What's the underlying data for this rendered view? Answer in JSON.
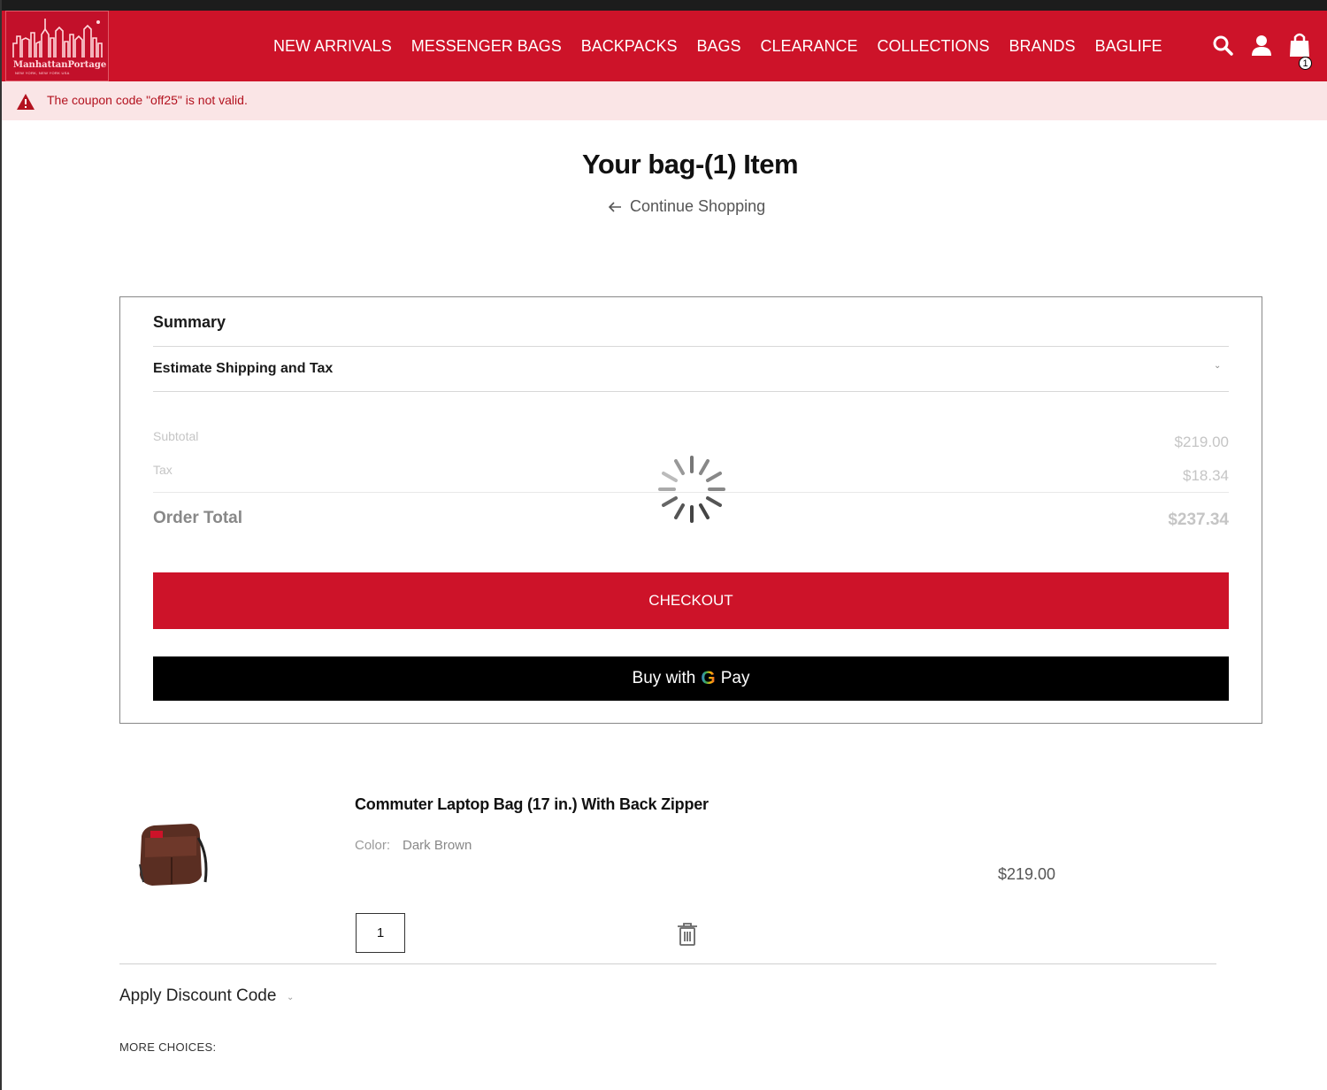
{
  "header": {
    "logo_text": "ManhattanPortage",
    "logo_sub": "NEW YORK, NEW YORK USA",
    "nav": [
      "NEW ARRIVALS",
      "MESSENGER BAGS",
      "BACKPACKS",
      "BAGS",
      "CLEARANCE",
      "COLLECTIONS",
      "BRANDS",
      "BAGLIFE"
    ],
    "cart_count": "1",
    "icons": [
      "search-icon",
      "account-icon",
      "cart-icon"
    ],
    "accent_color": "#cd1329"
  },
  "alert": {
    "message": "The coupon code \"off25\" is not valid.",
    "icon": "warning-icon",
    "background": "#fae5e6"
  },
  "page": {
    "title": "Your bag-(1) Item",
    "continue_label": "Continue Shopping"
  },
  "summary": {
    "title": "Summary",
    "estimate_label": "Estimate Shipping and Tax",
    "subtotal_label": "Subtotal",
    "subtotal_value": "$219.00",
    "tax_label": "Tax",
    "tax_value": "$18.34",
    "order_total_label": "Order Total",
    "order_total_value": "$237.34",
    "checkout_label": "CHECKOUT",
    "gpay_prefix": "Buy with",
    "gpay_g": "G",
    "gpay_suffix": "Pay",
    "loading": true
  },
  "cart_item": {
    "name": "Commuter Laptop Bag (17 in.) With Back Zipper",
    "color_label": "Color:",
    "color_value": "Dark Brown",
    "price": "$219.00",
    "quantity": "1"
  },
  "discount": {
    "label": "Apply Discount Code"
  },
  "more_choices": {
    "label": "MORE CHOICES:"
  }
}
